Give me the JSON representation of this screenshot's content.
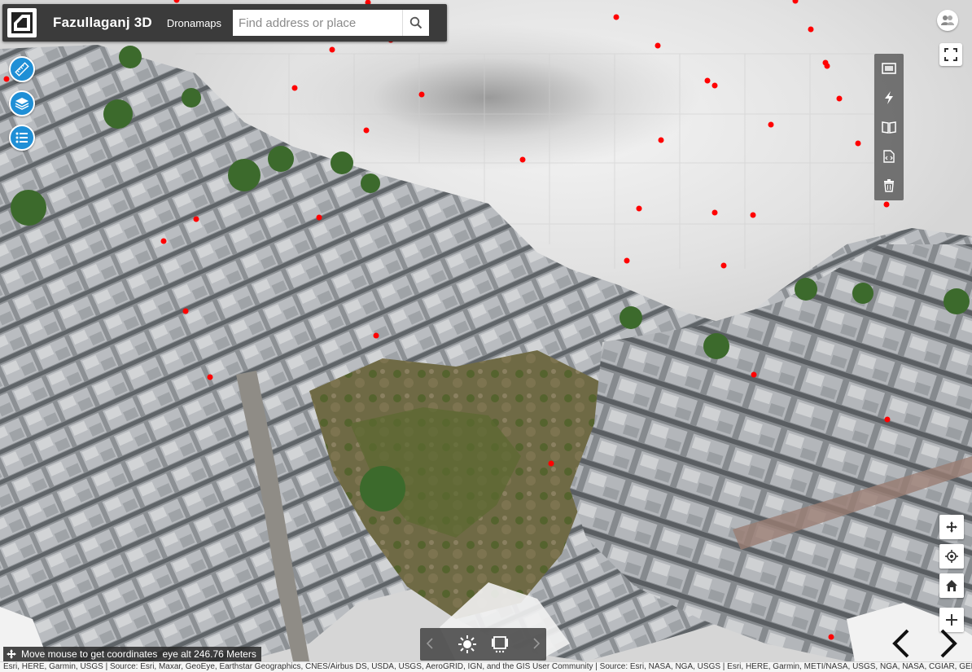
{
  "header": {
    "title": "Fazullaganj 3D",
    "subtitle": "Dronamaps",
    "search_placeholder": "Find address or place"
  },
  "coords": {
    "prompt": "Move mouse to get coordinates",
    "altitude": "eye alt 246.76 Meters"
  },
  "attribution": "Esri, HERE, Garmin, USGS | Source: Esri, Maxar, GeoEye, Earthstar Geographics, CNES/Airbus DS, USDA, USGS, AeroGRID, IGN, and the GIS User Community | Source: Esri, NASA, NGA, USGS | Esri, HERE, Garmin, METI/NASA, USGS, NGA, NASA, CGIAR, GEBCO,N Robinson, NCEAS, NLS, OS, NMA, Geodatastyrelsen and the GIS User Community | Powered by Esri",
  "icons": {
    "logo": "dronamaps-logo-icon",
    "search": "search-icon",
    "measure": "measure-ruler-icon",
    "layers": "layers-icon",
    "legend": "legend-list-icon",
    "share": "social-share-icon",
    "fullscreen": "fullscreen-icon",
    "basemap": "basemap-gallery-icon",
    "flash": "flash-icon",
    "bookmarks": "bookmarks-book-icon",
    "embed": "embed-code-icon",
    "delete": "trash-icon",
    "pan": "pan-move-icon",
    "locate": "locate-icon",
    "home": "home-icon",
    "zoom_in": "zoom-in-icon",
    "prev_slide": "chevron-left-icon",
    "next_slide": "chevron-right-icon",
    "daylight": "daylight-sun-icon",
    "slides": "slides-icon"
  },
  "colors": {
    "header_bg": "#3b3b3b",
    "accent_blue": "#1f8fd6",
    "marker_red": "#ff0000"
  }
}
